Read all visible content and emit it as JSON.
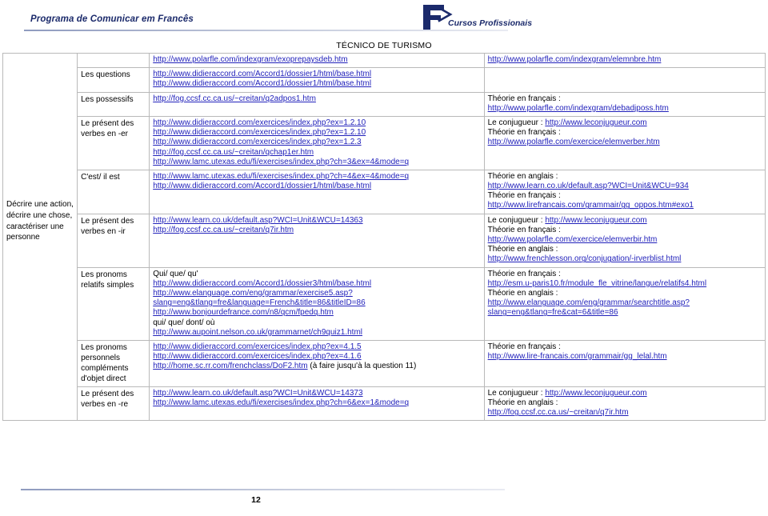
{
  "header": {
    "program_title": "Programa de Comunicar em Francês",
    "brand": "Cursos Profissionais",
    "logo_icon": "f-arrow-logo-icon"
  },
  "document": {
    "title": "TÉCNICO DE TURISMO",
    "page_number": "12"
  },
  "table": {
    "theme_label": "Décrire une action, décrire une chose, caractériser une personne",
    "rows": [
      {
        "topic": "",
        "links": [
          {
            "text": "http://www.polarfle.com/indexgram/exoprepaysdeb.htm",
            "link": true
          }
        ],
        "theory": [
          {
            "text": "http://www.polarfle.com/indexgram/elemnbre.htm",
            "link": true
          }
        ]
      },
      {
        "topic": "Les questions",
        "links": [
          {
            "text": "http://www.didieraccord.com/Accord1/dossier1/html/base.html",
            "link": true
          },
          {
            "text": "http://www.didieraccord.com/Accord1/dossier1/html/base.html",
            "link": true
          }
        ],
        "theory": []
      },
      {
        "topic": "Les possessifs",
        "links": [
          {
            "text": "http://fog.ccsf.cc.ca.us/~creitan/q2adpos1.htm",
            "link": true
          }
        ],
        "theory": [
          {
            "text": "Théorie en français :",
            "link": false
          },
          {
            "text": "http://www.polarfle.com/indexgram/debadjposs.htm",
            "link": true
          }
        ]
      },
      {
        "topic": "Le présent des verbes en -er",
        "links": [
          {
            "text": "http://www.didieraccord.com/exercices/index.php?ex=1.2.10",
            "link": true
          },
          {
            "text": "http://www.didieraccord.com/exercices/index.php?ex=1.2.10",
            "link": true
          },
          {
            "text": "http://www.didieraccord.com/exercices/index.php?ex=1.2.3",
            "link": true
          },
          {
            "text": "http://fog.ccsf.cc.ca.us/~creitan/qchap1er.htm",
            "link": true
          },
          {
            "text": "http://www.lamc.utexas.edu/fi/exercises/index.php?ch=3&ex=4&mode=q",
            "link": true
          }
        ],
        "theory": [
          {
            "prefix": "Le conjugueur : ",
            "text": "http://www.leconjugueur.com",
            "link": true
          },
          {
            "text": "Théorie en français :",
            "link": false
          },
          {
            "text": "http://www.polarfle.com/exercice/elemverber.htm",
            "link": true
          }
        ]
      },
      {
        "topic": "C'est/ il est",
        "links": [
          {
            "text": "http://www.lamc.utexas.edu/fi/exercises/index.php?ch=4&ex=4&mode=q",
            "link": true
          },
          {
            "text": "http://www.didieraccord.com/Accord1/dossier1/html/base.html",
            "link": true
          }
        ],
        "theory": [
          {
            "text": "Théorie en anglais :",
            "link": false
          },
          {
            "text": "http://www.learn.co.uk/default.asp?WCI=Unit&WCU=934",
            "link": true
          },
          {
            "text": "Théorie en français :",
            "link": false
          },
          {
            "text": "http://www.lirefrancais.com/grammair/gg_oppos.htm#exo1",
            "link": true
          }
        ]
      },
      {
        "topic": "Le présent des verbes en -ir",
        "links": [
          {
            "text": "http://www.learn.co.uk/default.asp?WCI=Unit&WCU=14363",
            "link": true
          },
          {
            "text": "http://fog.ccsf.cc.ca.us/~creitan/q7ir.htm",
            "link": true
          }
        ],
        "theory": [
          {
            "prefix": "Le conjugueur : ",
            "text": "http://www.leconjugueur.com",
            "link": true
          },
          {
            "text": "Théorie en français :",
            "link": false
          },
          {
            "text": "http://www.polarfle.com/exercice/elemverbir.htm",
            "link": true
          },
          {
            "text": "Théorie en anglais :",
            "link": false
          },
          {
            "text": "http://www.frenchlesson.org/conjugation/-irverblist.html",
            "link": true
          }
        ]
      },
      {
        "topic": "Les pronoms relatifs simples",
        "links": [
          {
            "text": "Qui/ que/ qu'",
            "link": false
          },
          {
            "text": "http://www.didieraccord.com/Accord1/dossier3/html/base.html",
            "link": true
          },
          {
            "text": "http://www.elanguage.com/eng/grammar/exercise5.asp?slang=eng&tlang=fre&language=French&title=86&titleID=86",
            "link": true,
            "wrap": true
          },
          {
            "text": "http://www.bonjourdefrance.com/n8/qcm/fpedq.htm",
            "link": true
          },
          {
            "text": "qui/ que/ dont/ où",
            "link": false
          },
          {
            "text": "http://www.aupoint.nelson.co.uk/grammarnet/ch9quiz1.html",
            "link": true
          }
        ],
        "theory": [
          {
            "text": "Théorie en français :",
            "link": false
          },
          {
            "text": " http://esm.u-paris10.fr/module_fle_vitrine/langue/relatifs4.html",
            "link": true,
            "wrap": true
          },
          {
            "text": "Théorie en anglais :",
            "link": false
          },
          {
            "text": "http://www.elanguage.com/eng/grammar/searchtitle.asp?slang=eng&tlang=fre&cat=6&title=86",
            "link": true,
            "wrap": true
          }
        ]
      },
      {
        "topic": "Les pronoms personnels compléments d'objet direct",
        "links": [
          {
            "text": "http://www.didieraccord.com/exercices/index.php?ex=4.1.5",
            "link": true
          },
          {
            "text": "http://www.didieraccord.com/exercices/index.php?ex=4.1.6",
            "link": true
          },
          {
            "text": "http://home.sc.rr.com/frenchclass/DoF2.htm",
            "link": true,
            "suffix": " (à faire jusqu'à la question 11)"
          }
        ],
        "theory": [
          {
            "text": "Théorie en français :",
            "link": false
          },
          {
            "text": "http://www.lire-francais.com/grammair/gg_lelal.htm",
            "link": true
          }
        ]
      },
      {
        "topic": "Le présent des verbes en -re",
        "links": [
          {
            "text": "http://www.learn.co.uk/default.asp?WCI=Unit&WCU=14373",
            "link": true
          },
          {
            "text": "http://www.lamc.utexas.edu/fi/exercises/index.php?ch=6&ex=1&mode=q",
            "link": true
          }
        ],
        "theory": [
          {
            "prefix": "Le conjugueur : ",
            "text": "http://www.leconjugueur.com",
            "link": true
          },
          {
            "text": "Théorie en anglais :",
            "link": false
          },
          {
            "text": "http://fog.ccsf.cc.ca.us/~creitan/q7ir.htm",
            "link": true
          }
        ]
      }
    ]
  },
  "colors": {
    "brand": "#1b2a6b",
    "link": "#2222bb",
    "border": "#b9b9b9"
  }
}
